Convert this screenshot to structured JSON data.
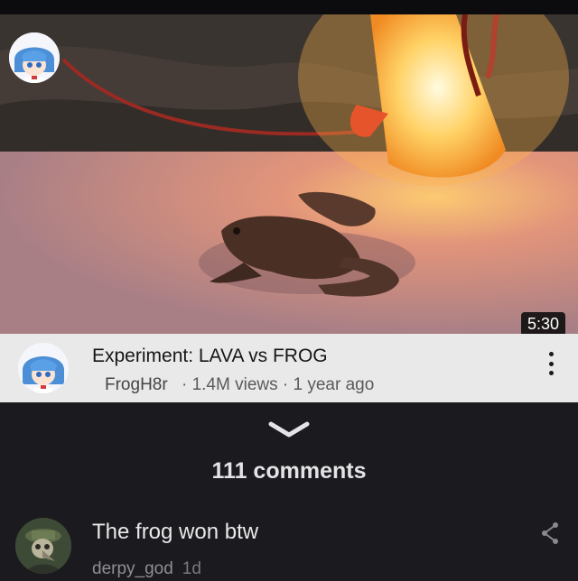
{
  "video": {
    "duration": "5:30",
    "title": "Experiment: LAVA vs FROG",
    "channel": "FrogH8r",
    "separator": "·",
    "views": "1.4M views",
    "age": "1 year ago",
    "more_icon": "more-vertical-icon"
  },
  "comments": {
    "collapse_icon": "chevron-down-icon",
    "count_label": "111 comments",
    "items": [
      {
        "text": "The frog won btw",
        "author": "derpy_god",
        "time": "1d",
        "share_icon": "share-icon"
      }
    ]
  },
  "colors": {
    "meta_background": "#e9e9ea",
    "panel_background": "#1b1b1f",
    "thumbnail_glow": "#ffc048"
  }
}
